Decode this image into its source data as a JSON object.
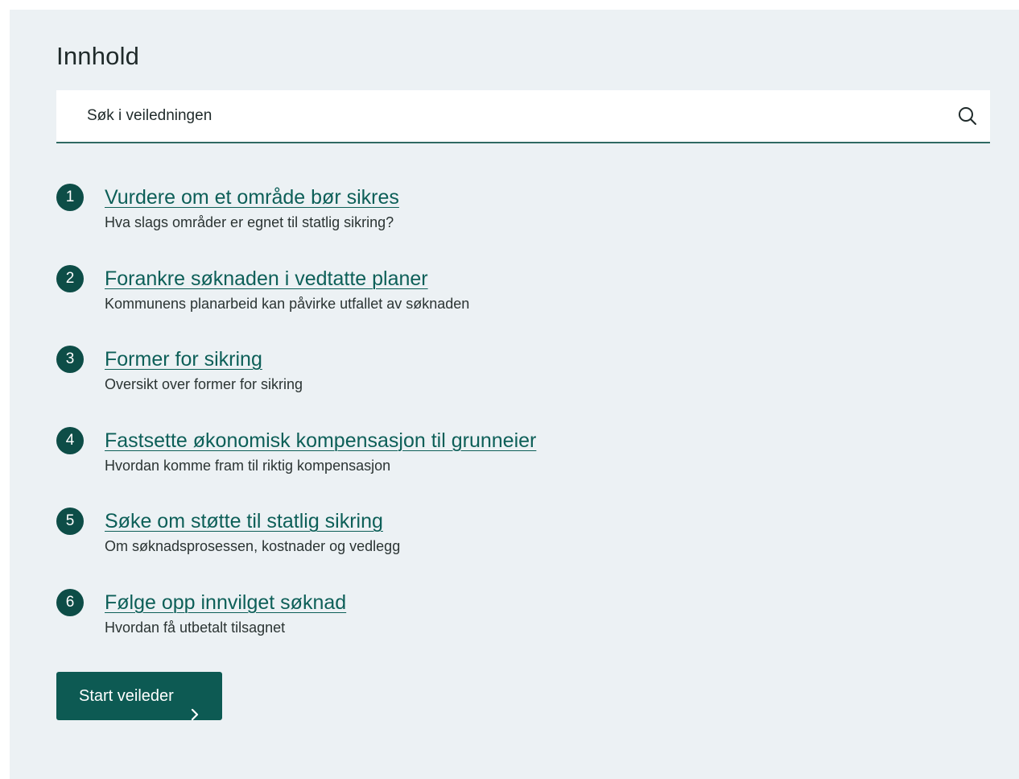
{
  "heading": "Innhold",
  "search": {
    "placeholder": "Søk i veiledningen",
    "icon": "search-icon"
  },
  "steps": [
    {
      "number": "1",
      "title": "Vurdere om et område bør sikres",
      "description": "Hva slags områder er egnet til statlig sikring?"
    },
    {
      "number": "2",
      "title": "Forankre søknaden i vedtatte planer",
      "description": "Kommunens planarbeid kan påvirke utfallet av søknaden"
    },
    {
      "number": "3",
      "title": "Former for sikring",
      "description": "Oversikt over former for sikring"
    },
    {
      "number": "4",
      "title": "Fastsette økonomisk kompensasjon til grunneier",
      "description": "Hvordan komme fram til riktig kompensasjon"
    },
    {
      "number": "5",
      "title": "Søke om støtte til statlig sikring",
      "description": "Om søknadsprosessen, kostnader og vedlegg"
    },
    {
      "number": "6",
      "title": "Følge opp innvilget søknad",
      "description": "Hvordan få utbetalt tilsagnet"
    }
  ],
  "start_button": {
    "label": "Start veileder",
    "icon": "chevron-right-icon"
  },
  "colors": {
    "panel_bg": "#ecf1f4",
    "accent": "#0d5a53",
    "link": "#0d5f58"
  }
}
